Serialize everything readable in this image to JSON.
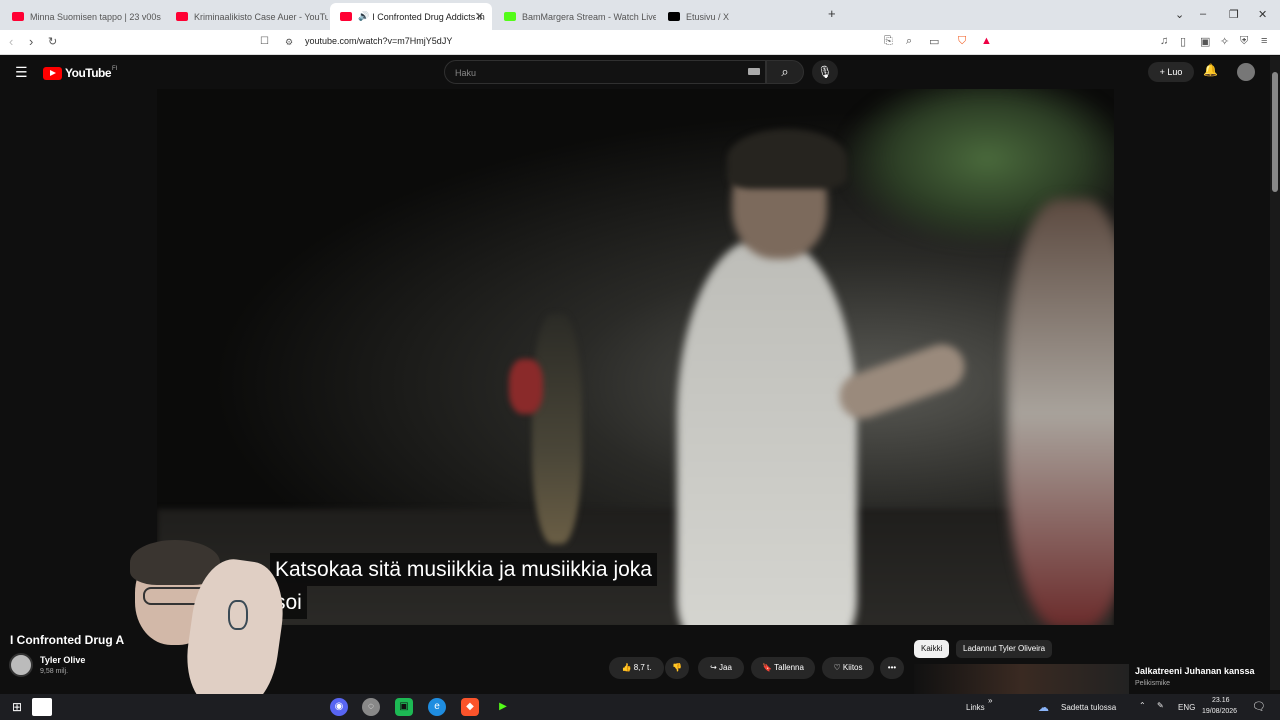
{
  "browser": {
    "tabs": [
      {
        "label": "Minna Suomisen tappo | 23 v00s - H",
        "color": "#ff0033"
      },
      {
        "label": "Kriminaalikisto Case Auer - YouTube",
        "color": "#ff0033"
      },
      {
        "label": "I Confronted Drug Addicts in",
        "color": "#ff0033",
        "active": true,
        "audio": "speaker-icon"
      },
      {
        "label": "BamMargera Stream - Watch Live on",
        "color": "#53fc18"
      },
      {
        "label": "Etusivu / X",
        "color": "#000000"
      }
    ],
    "new_tab": "+",
    "tab_close": "✕",
    "window_controls": [
      "⌄",
      "–",
      "❐",
      "✕"
    ],
    "url": "youtube.com/watch?v=m7HmjY5dJY"
  },
  "youtube": {
    "logo_text": "YouTube",
    "logo_sup": "FI",
    "search_placeholder": "Haku",
    "create_label": "+ Luo",
    "video": {
      "caption_line1": "Katsokaa sitä musiikkia ja musiikkia joka",
      "caption_line2": "soi"
    },
    "title": "I Confronted Drug A",
    "channel_name": "Tyler Olive",
    "channel_subs": "9,58 milj.",
    "actions": {
      "likes": "8,7 t.",
      "share": "Jaa",
      "save": "Tallenna",
      "thanks": "Kiitos",
      "more": "•••"
    },
    "chips": [
      "Kaikki",
      "Ladannut Tyler Oliveira"
    ],
    "recommendation": {
      "title": "Jalkatreeni Juhanan kanssa",
      "channel": "Pelikismike"
    }
  },
  "taskbar": {
    "links": "Links",
    "weather": "Sadetta tulossa",
    "language": "ENG",
    "time": "23.16",
    "date": "19/08/2026"
  },
  "colors": {
    "youtube_red": "#ff0000",
    "yt_bg": "#0f0f0f",
    "chip_active": "#f1f1f1"
  }
}
